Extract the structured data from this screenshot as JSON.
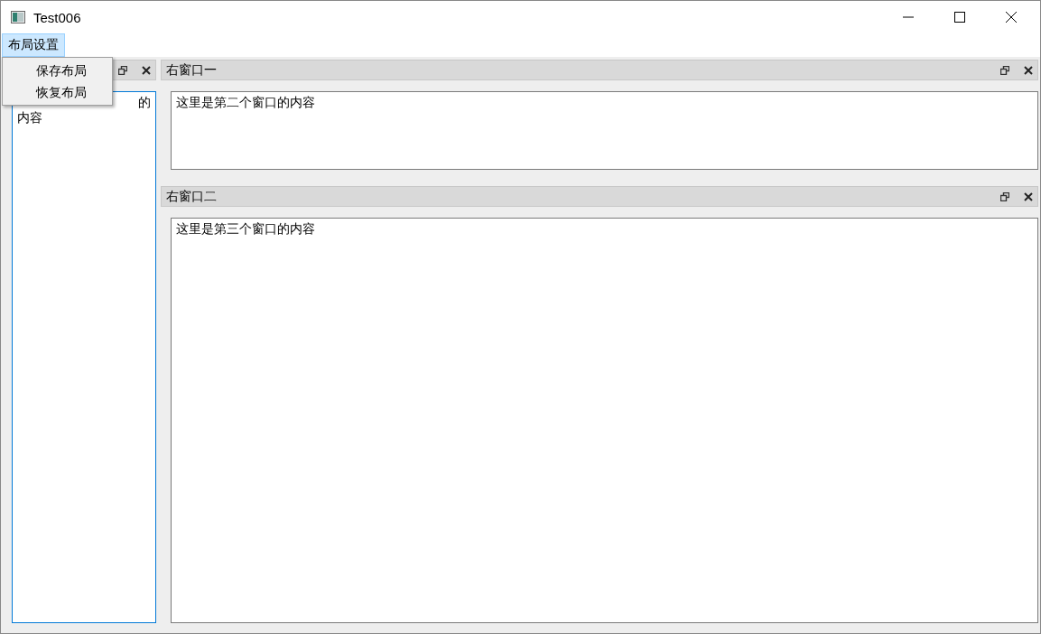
{
  "window": {
    "title": "Test006"
  },
  "menubar": [
    {
      "label": "布局设置",
      "selected": true
    }
  ],
  "open_menu": {
    "items": [
      {
        "label": "保存布局"
      },
      {
        "label": "恢复布局"
      }
    ]
  },
  "left_docks": [
    {
      "focused": true,
      "content_lines": [
        "的",
        "内容"
      ]
    }
  ],
  "right_docks": [
    {
      "title": "右窗口一",
      "focused": false,
      "content_lines": [
        "这里是第二个窗口的内容"
      ]
    },
    {
      "title": "右窗口二",
      "focused": false,
      "content_lines": [
        "这里是第三个窗口的内容"
      ]
    }
  ]
}
